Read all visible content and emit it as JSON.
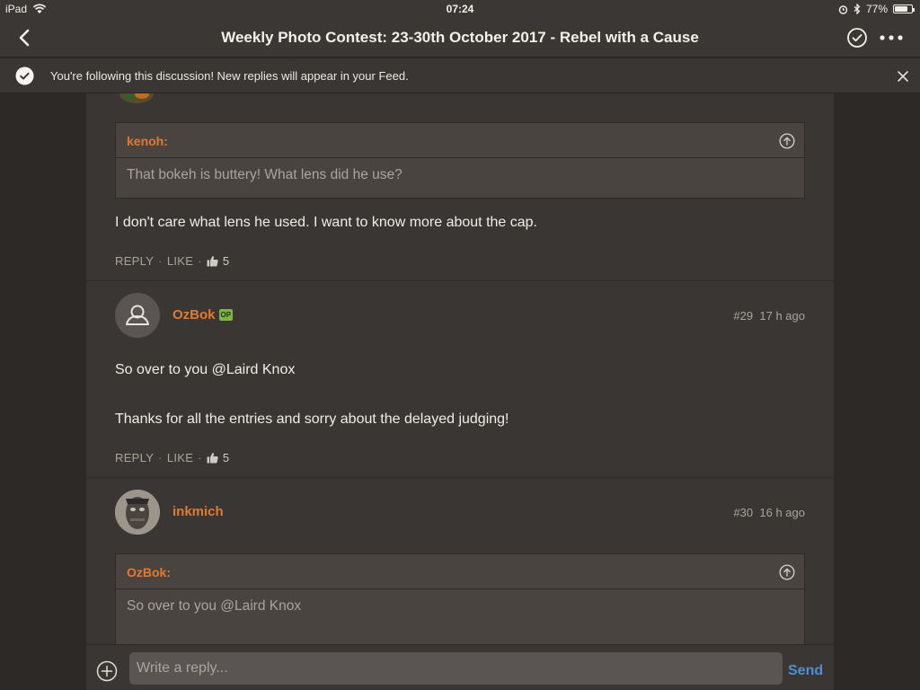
{
  "status_bar": {
    "device": "iPad",
    "time": "07:24",
    "battery": "77%",
    "battery_level": 0.77
  },
  "nav": {
    "title": "Weekly Photo Contest: 23-30th October 2017 - Rebel with a Cause"
  },
  "notice": {
    "text": "You're following this discussion! New replies will appear in your Feed."
  },
  "posts": [
    {
      "quote": {
        "author": "kenoh:",
        "text": "That bokeh is buttery! What lens did he use?"
      },
      "text": "I don't care what lens he used. I want to know more about the cap.",
      "actions": {
        "reply": "REPLY",
        "like": "LIKE",
        "likes": "5"
      }
    },
    {
      "username": "OzBok",
      "badge": "OP",
      "number": "#29",
      "time": "17 h ago",
      "paragraphs": [
        "So over to you @Laird Knox",
        "Thanks for all the entries and sorry about the delayed judging!"
      ],
      "actions": {
        "reply": "REPLY",
        "like": "LIKE",
        "likes": "5"
      }
    },
    {
      "username": "inkmich",
      "number": "#30",
      "time": "16 h ago",
      "quote": {
        "author": "OzBok:",
        "text": "So over to you @Laird Knox"
      }
    }
  ],
  "reply_bar": {
    "placeholder": "Write a reply...",
    "send_label": "Send"
  },
  "colors": {
    "accent": "#e07a32",
    "link": "#4e8fd6",
    "background": "#3a3633",
    "op_badge": "#7bb83a"
  },
  "icons": {
    "back": "chevron-left-icon",
    "follow": "check-circle-icon",
    "more": "more-dots-icon",
    "close": "close-icon",
    "quote_jump": "arrow-up-circle-icon",
    "like": "thumbs-up-icon",
    "add": "plus-circle-icon",
    "wifi": "wifi-icon",
    "alarm": "alarm-icon",
    "bluetooth": "bluetooth-icon",
    "battery": "battery-icon"
  }
}
